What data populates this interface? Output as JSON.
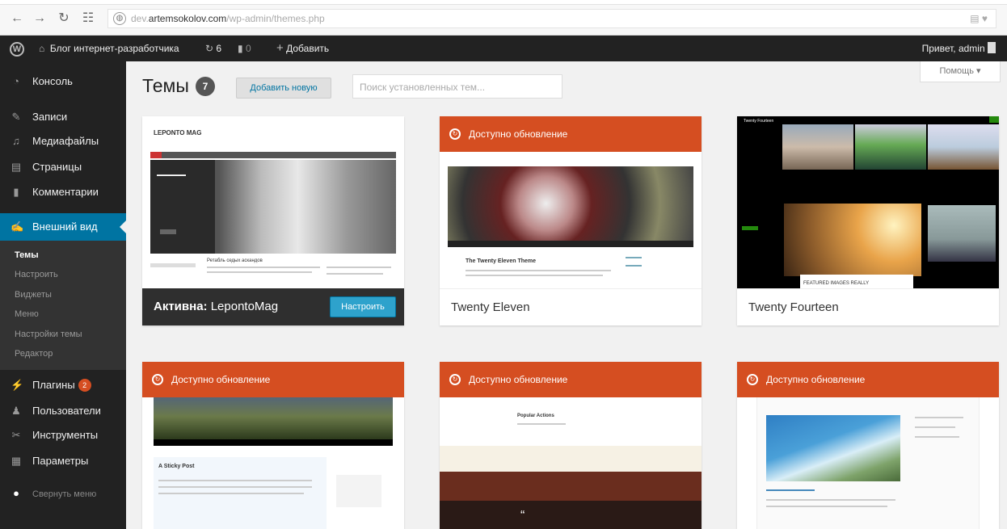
{
  "browser": {
    "url_prefix": "dev.",
    "url_domain": "artemsokolov.com",
    "url_path": "/wp-admin/themes.php"
  },
  "adminbar": {
    "site_name": "Блог интернет-разработчика",
    "updates_count": "6",
    "comments_count": "0",
    "add_label": "Добавить",
    "greeting": "Привет, admin"
  },
  "sidebar": {
    "items": [
      {
        "label": "Консоль",
        "icon": "dashboard-icon"
      },
      {
        "label": "Записи",
        "icon": "pin-icon"
      },
      {
        "label": "Медиафайлы",
        "icon": "media-icon"
      },
      {
        "label": "Страницы",
        "icon": "pages-icon"
      },
      {
        "label": "Комментарии",
        "icon": "comments-icon"
      },
      {
        "label": "Внешний вид",
        "icon": "appearance-icon"
      },
      {
        "label": "Плагины",
        "icon": "plugins-icon"
      },
      {
        "label": "Пользователи",
        "icon": "users-icon"
      },
      {
        "label": "Инструменты",
        "icon": "tools-icon"
      },
      {
        "label": "Параметры",
        "icon": "settings-icon"
      }
    ],
    "submenu": [
      "Темы",
      "Настроить",
      "Виджеты",
      "Меню",
      "Настройки темы",
      "Редактор"
    ],
    "plugins_badge": "2",
    "collapse_label": "Свернуть меню"
  },
  "header": {
    "title": "Темы",
    "count": "7",
    "add_new_label": "Добавить новую",
    "search_placeholder": "Поиск установленных тем...",
    "help_label": "Помощь ▾"
  },
  "themes": {
    "active_prefix": "Активна:",
    "active_name": "LepontoMag",
    "customize_label": "Настроить",
    "update_label": "Доступно обновление",
    "names": [
      "Twenty Eleven",
      "Twenty Fourteen"
    ],
    "shot_text": {
      "leponto_logo": "LEPONTO MAG",
      "leponto_head": "Ретабль седых аскандов",
      "eleven_title": "The Twenty Eleven Theme",
      "fourteen_brand": "Twenty Fourteen",
      "fourteen_featured": "FEATURED IMAGES REALLY",
      "ten_post": "A Sticky Post",
      "popular": "Popular Actions"
    }
  },
  "colors": {
    "admin_dark": "#222222",
    "accent": "#0074a2",
    "update": "#d54e21",
    "button": "#2ea2cc"
  }
}
